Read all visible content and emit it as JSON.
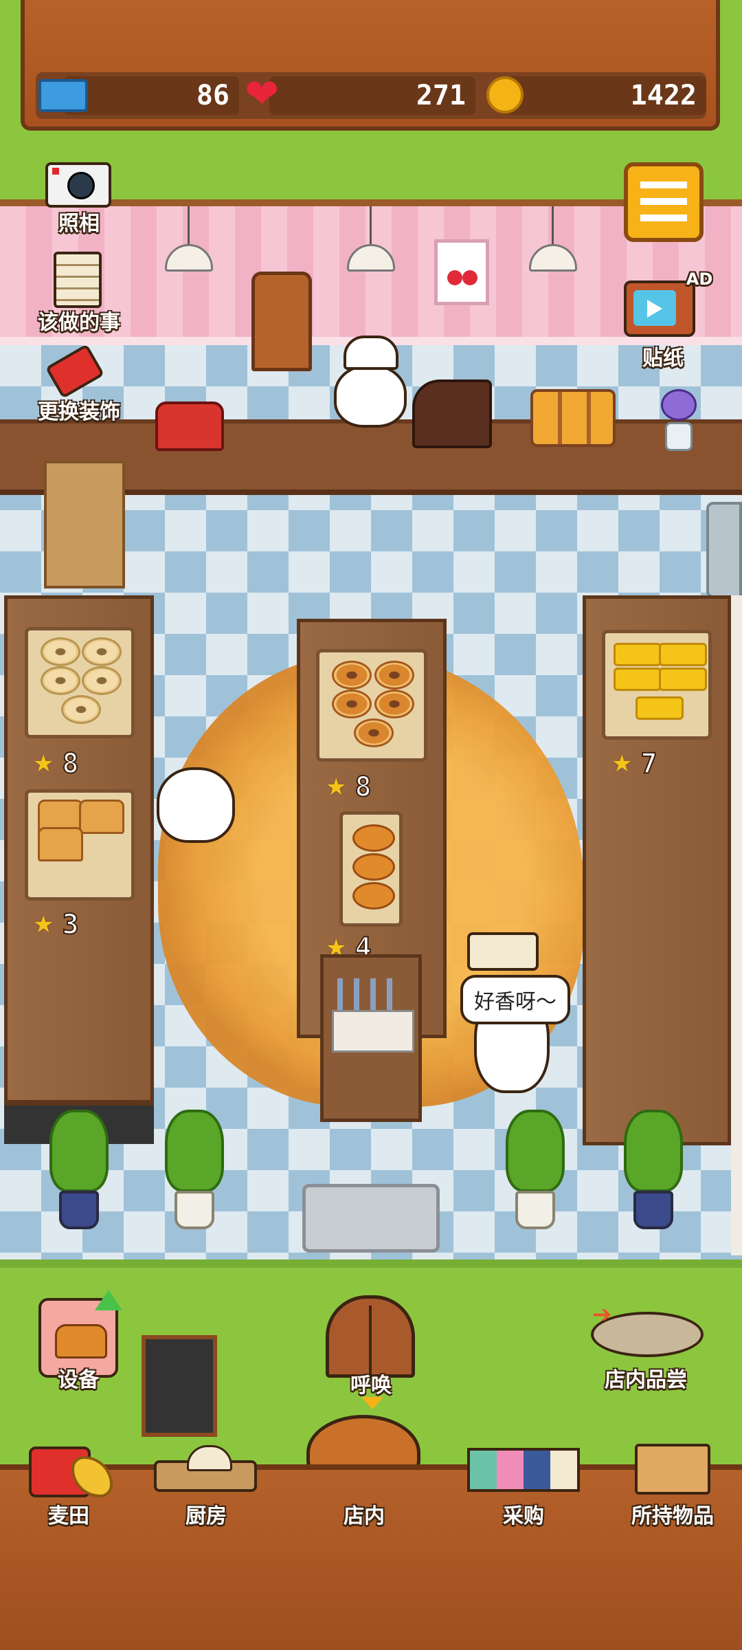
{
  "stats": {
    "tickets": "86",
    "hearts": "271",
    "coins": "1422"
  },
  "top_buttons": {
    "camera_label": "照相",
    "todo_label": "该做的事",
    "decorate_label": "更换装饰",
    "sticker_label": "贴纸",
    "sticker_badge": "AD"
  },
  "shelves": {
    "left_top_rating": "8",
    "left_bottom_rating": "3",
    "center_top_rating": "8",
    "center_bottom_rating": "4",
    "right_rating": "7"
  },
  "customer_speech": "好香呀～",
  "bottom_actions": {
    "equipment_label": "设备",
    "call_label": "呼唤",
    "tasting_label": "店内品尝"
  },
  "nav": {
    "items": [
      {
        "label": "麦田"
      },
      {
        "label": "厨房"
      },
      {
        "label": "店内"
      },
      {
        "label": "采购"
      },
      {
        "label": "所持物品"
      }
    ]
  },
  "colors": {
    "grass": "#8cc63f",
    "wood": "#a9521f",
    "menu_button": "#f7b218",
    "wall_pink": "#f7c6d4"
  },
  "icons": [
    "ticket-icon",
    "heart-icon",
    "coin-icon",
    "camera-icon",
    "clipboard-icon",
    "paint-roller-icon",
    "hamburger-menu-icon",
    "tv-icon",
    "star-icon",
    "bread-basket-icon",
    "shop-door-icon",
    "wheat-icon",
    "kitchen-icon",
    "shopping-icon",
    "box-icon"
  ]
}
